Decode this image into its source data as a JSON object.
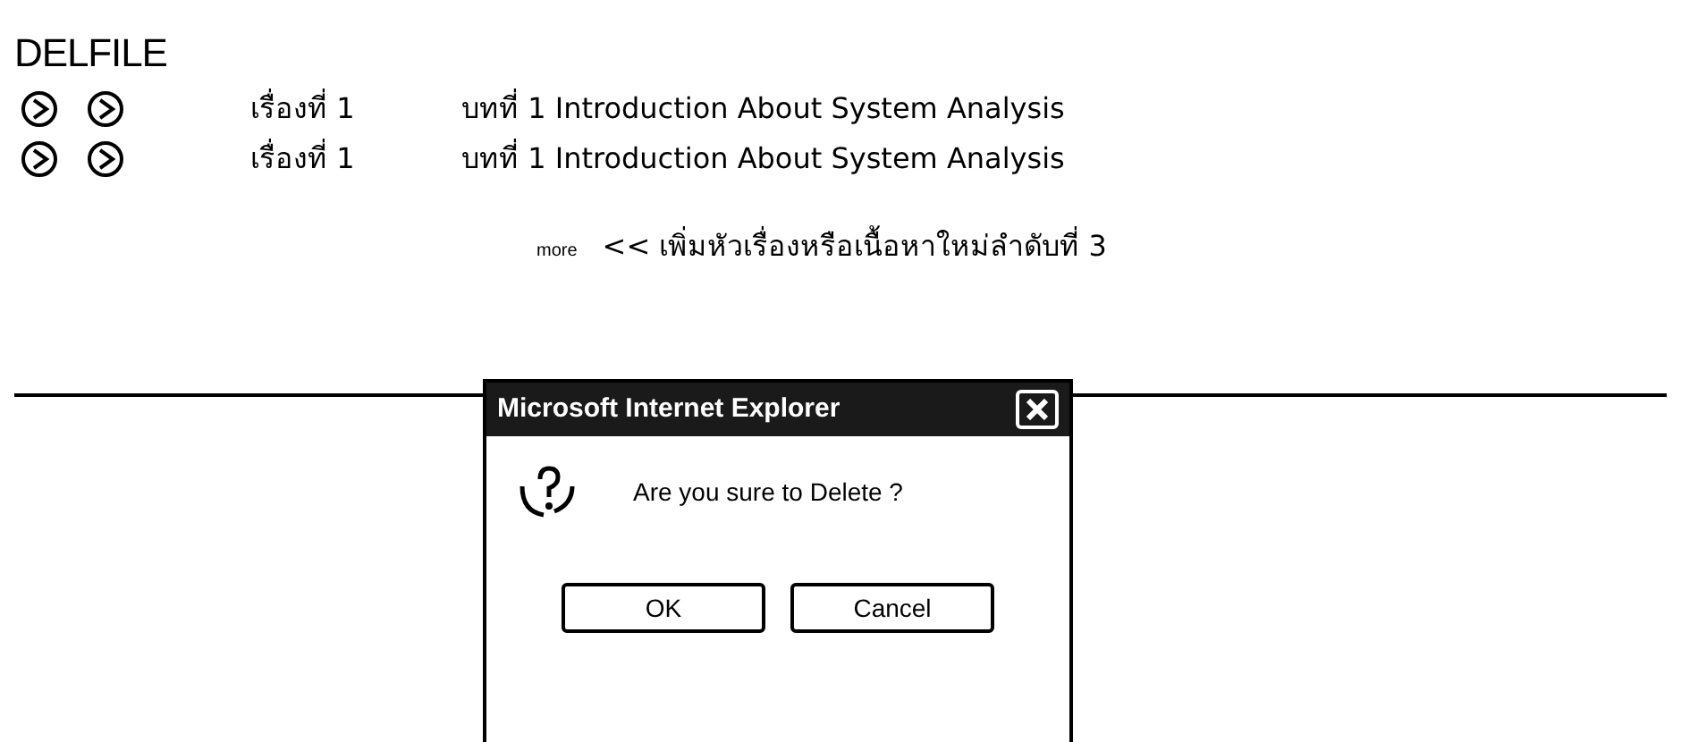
{
  "page": {
    "title": "DELFILE"
  },
  "rows": [
    {
      "topic": "เรื่องที่ 1",
      "chapter": "บทที่ 1 Introduction About System Analysis"
    },
    {
      "topic": "เรื่องที่ 1",
      "chapter": "บทที่ 1 Introduction About System Analysis"
    }
  ],
  "more": {
    "label": "more",
    "link": "<< เพิ่มหัวเรื่องหรือเนื้อหาใหม่ลำดับที่ 3"
  },
  "dialog": {
    "title": "Microsoft Internet Explorer",
    "message": "Are you sure to Delete ?",
    "buttons": [
      "OK",
      "Cancel"
    ]
  }
}
